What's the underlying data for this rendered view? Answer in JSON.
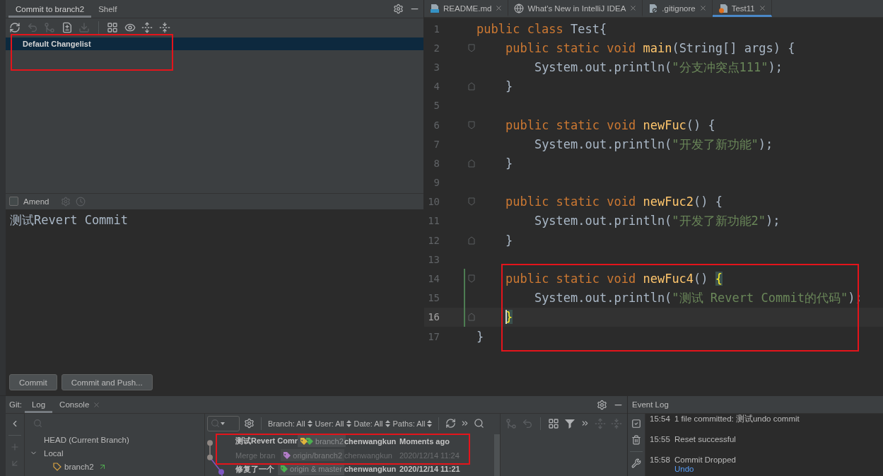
{
  "commit_panel": {
    "tabs": [
      {
        "label": "Commit to branch2",
        "selected": true
      },
      {
        "label": "Shelf",
        "selected": false
      }
    ],
    "toolbar": [
      {
        "disabled": false
      },
      {
        "disabled": true
      },
      {
        "disabled": true
      },
      {
        "disabled": false
      },
      {
        "disabled": true
      },
      {
        "disabled": false
      },
      {
        "disabled": false
      },
      {
        "disabled": false
      },
      {
        "disabled": false
      }
    ],
    "changelists": [
      {
        "label": "Default Changelist",
        "selected": true,
        "highlighted": true
      }
    ],
    "amend": {
      "label": "Amend",
      "checked": false
    },
    "message": "测试Revert Commit",
    "buttons": [
      "Commit",
      "Commit and Push..."
    ]
  },
  "editor": {
    "tabs": [
      {
        "kind": "markdown",
        "label": "README.md",
        "selected": false
      },
      {
        "kind": "web",
        "label": "What's New in IntelliJ IDEA",
        "selected": false
      },
      {
        "kind": "ignore",
        "label": ".gitignore",
        "selected": false
      },
      {
        "kind": "java",
        "label": "Test11",
        "selected": true
      }
    ],
    "lines": [
      {
        "number": "1",
        "fold_start": false,
        "fold_end": false,
        "changed": false,
        "current": false,
        "highlighted": false,
        "tokens": [
          {
            "kind": "keyword",
            "text": "public class"
          },
          {
            "kind": "plain",
            "text": " Test{"
          }
        ]
      },
      {
        "number": "2",
        "fold_start": true,
        "fold_end": false,
        "changed": false,
        "current": false,
        "highlighted": false,
        "tokens": [
          {
            "kind": "keyword",
            "text": "    public static void"
          },
          {
            "kind": "method",
            "text": " main"
          },
          {
            "kind": "plain",
            "text": "(String[] args) {"
          }
        ]
      },
      {
        "number": "3",
        "fold_start": false,
        "fold_end": false,
        "changed": false,
        "current": false,
        "highlighted": false,
        "tokens": [
          {
            "kind": "plain",
            "text": "        System.out.println("
          },
          {
            "kind": "string",
            "text": "\"分支冲突点111\""
          },
          {
            "kind": "plain",
            "text": ");"
          }
        ]
      },
      {
        "number": "4",
        "fold_start": false,
        "fold_end": true,
        "changed": false,
        "current": false,
        "highlighted": false,
        "tokens": [
          {
            "kind": "plain",
            "text": "    }"
          }
        ]
      },
      {
        "number": "5",
        "fold_start": false,
        "fold_end": false,
        "changed": false,
        "current": false,
        "highlighted": false
      },
      {
        "number": "6",
        "fold_start": true,
        "fold_end": false,
        "changed": false,
        "current": false,
        "highlighted": false,
        "tokens": [
          {
            "kind": "keyword",
            "text": "    public static void"
          },
          {
            "kind": "method",
            "text": " newFuc"
          },
          {
            "kind": "plain",
            "text": "() {"
          }
        ]
      },
      {
        "number": "7",
        "fold_start": false,
        "fold_end": false,
        "changed": false,
        "current": false,
        "highlighted": false,
        "tokens": [
          {
            "kind": "plain",
            "text": "        System.out.println("
          },
          {
            "kind": "string",
            "text": "\"开发了新功能\""
          },
          {
            "kind": "plain",
            "text": ");"
          }
        ]
      },
      {
        "number": "8",
        "fold_start": false,
        "fold_end": true,
        "changed": false,
        "current": false,
        "highlighted": false,
        "tokens": [
          {
            "kind": "plain",
            "text": "    }"
          }
        ]
      },
      {
        "number": "9",
        "fold_start": false,
        "fold_end": false,
        "changed": false,
        "current": false,
        "highlighted": false
      },
      {
        "number": "10",
        "fold_start": true,
        "fold_end": false,
        "changed": false,
        "current": false,
        "highlighted": false,
        "tokens": [
          {
            "kind": "keyword",
            "text": "    public static void"
          },
          {
            "kind": "method",
            "text": " newFuc2"
          },
          {
            "kind": "plain",
            "text": "() {"
          }
        ]
      },
      {
        "number": "11",
        "fold_start": false,
        "fold_end": false,
        "changed": false,
        "current": false,
        "highlighted": false,
        "tokens": [
          {
            "kind": "plain",
            "text": "        System.out.println("
          },
          {
            "kind": "string",
            "text": "\"开发了新功能2\""
          },
          {
            "kind": "plain",
            "text": ");"
          }
        ]
      },
      {
        "number": "12",
        "fold_start": false,
        "fold_end": true,
        "changed": false,
        "current": false,
        "highlighted": false,
        "tokens": [
          {
            "kind": "plain",
            "text": "    }"
          }
        ]
      },
      {
        "number": "13",
        "fold_start": false,
        "fold_end": false,
        "changed": false,
        "current": false,
        "highlighted": false
      },
      {
        "number": "14",
        "fold_start": true,
        "fold_end": false,
        "changed": true,
        "current": false,
        "highlighted": true,
        "tokens": [
          {
            "kind": "keyword",
            "text": "    public static void"
          },
          {
            "kind": "method",
            "text": " newFuc4"
          },
          {
            "kind": "plain",
            "text": "() "
          },
          {
            "kind": "brace",
            "text": "{"
          }
        ]
      },
      {
        "number": "15",
        "fold_start": false,
        "fold_end": false,
        "changed": true,
        "current": false,
        "highlighted": true,
        "tokens": [
          {
            "kind": "plain",
            "text": "        System.out.println("
          },
          {
            "kind": "string",
            "text": "\"测试 Revert Commit的代码\""
          },
          {
            "kind": "plain",
            "text": ");"
          }
        ]
      },
      {
        "number": "16",
        "fold_start": false,
        "fold_end": true,
        "changed": true,
        "current": true,
        "highlighted": true,
        "tokens": [
          {
            "kind": "brace",
            "text": "    }"
          }
        ]
      },
      {
        "number": "17",
        "fold_start": false,
        "fold_end": false,
        "changed": false,
        "current": false,
        "highlighted": false,
        "tokens": [
          {
            "kind": "plain",
            "text": "}"
          }
        ]
      }
    ]
  },
  "git_panel": {
    "title": "Git:",
    "tabs": [
      {
        "label": "Log",
        "selected": true,
        "closable": false
      },
      {
        "label": "Console",
        "selected": false,
        "closable": true
      }
    ],
    "side_toolbar": [
      {
        "disabled": false
      },
      {
        "disabled": true
      },
      {
        "disabled": true
      }
    ],
    "branches": [
      {
        "kind": "head",
        "label": "HEAD (Current Branch)"
      },
      {
        "kind": "group",
        "label": "Local",
        "expanded": true,
        "children": [
          {
            "kind": "branch",
            "label": "branch2",
            "outgoing": true
          }
        ]
      }
    ],
    "filters": [
      "Branch: All",
      "User: All",
      "Date: All",
      "Paths: All"
    ],
    "commits": [
      {
        "subject": "测试Revert Comr",
        "tags": [
          {
            "color": "#e0b43c"
          },
          {
            "color": "#4caf50"
          }
        ],
        "ref": "branch2",
        "author": "chenwangkun",
        "date": "Moments ago",
        "dimmed": false,
        "highlighted": true,
        "color": "#8e8682"
      },
      {
        "subject": "Merge bran",
        "tags": [
          {
            "color": "#b07cc6"
          }
        ],
        "ref": "origin/branch2",
        "author": "chenwangkun",
        "date": "2020/12/14 11:24",
        "dimmed": true,
        "highlighted": true,
        "color": "#8e8682"
      },
      {
        "subject": "修复了一个",
        "tags": [
          {
            "color": "#4caf50"
          }
        ],
        "ref": "origin & master",
        "author": "chenwangkun",
        "date": "2020/12/14 11:21",
        "dimmed": false,
        "highlighted": false,
        "color": "#7e57c2"
      }
    ],
    "details_toolbar": [
      {
        "disabled": true
      },
      {
        "disabled": true
      },
      {
        "disabled": false
      },
      {
        "disabled": false
      },
      {
        "disabled": false
      },
      {
        "disabled": true
      },
      {
        "disabled": true
      }
    ]
  },
  "event_log": {
    "title": "Event Log",
    "entries": [
      {
        "time": "15:54",
        "text": "1 file committed: 测试undo commit"
      },
      {
        "time": "15:55",
        "text": "Reset successful"
      },
      {
        "time": "15:58",
        "text": "Commit Dropped",
        "link": "Undo"
      }
    ]
  }
}
